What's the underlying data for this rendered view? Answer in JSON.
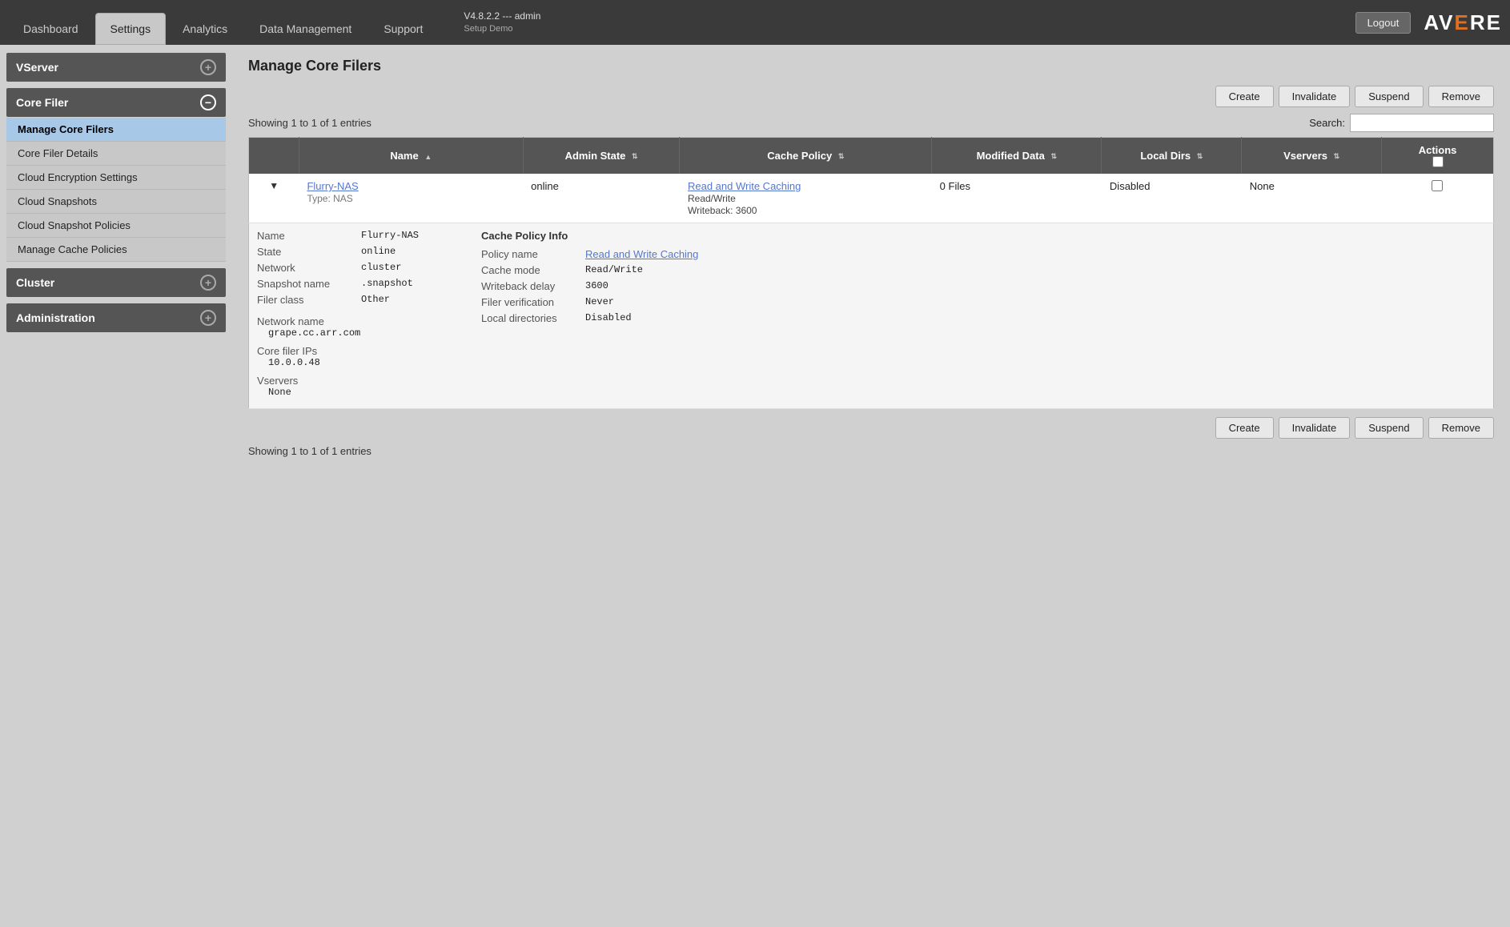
{
  "app": {
    "logo": "AVERE",
    "logo_accent": "E",
    "version": "V4.8.2.2 --- admin",
    "setup": "Setup Demo"
  },
  "top_nav": {
    "logout_label": "Logout",
    "tabs": [
      {
        "id": "dashboard",
        "label": "Dashboard",
        "active": false
      },
      {
        "id": "settings",
        "label": "Settings",
        "active": true
      },
      {
        "id": "analytics",
        "label": "Analytics",
        "active": false
      },
      {
        "id": "data-management",
        "label": "Data Management",
        "active": false
      },
      {
        "id": "support",
        "label": "Support",
        "active": false
      }
    ]
  },
  "sidebar": {
    "sections": [
      {
        "id": "vserver",
        "label": "VServer",
        "collapsed": true,
        "icon": "plus",
        "items": []
      },
      {
        "id": "core-filer",
        "label": "Core Filer",
        "collapsed": false,
        "icon": "minus",
        "items": [
          {
            "id": "manage-core-filers",
            "label": "Manage Core Filers",
            "active": true
          },
          {
            "id": "core-filer-details",
            "label": "Core Filer Details",
            "active": false
          },
          {
            "id": "cloud-encryption-settings",
            "label": "Cloud Encryption Settings",
            "active": false
          },
          {
            "id": "cloud-snapshots",
            "label": "Cloud Snapshots",
            "active": false
          },
          {
            "id": "cloud-snapshot-policies",
            "label": "Cloud Snapshot Policies",
            "active": false
          },
          {
            "id": "manage-cache-policies",
            "label": "Manage Cache Policies",
            "active": false
          }
        ]
      },
      {
        "id": "cluster",
        "label": "Cluster",
        "collapsed": true,
        "icon": "plus",
        "items": []
      },
      {
        "id": "administration",
        "label": "Administration",
        "collapsed": true,
        "icon": "plus",
        "items": []
      }
    ]
  },
  "content": {
    "page_title": "Manage Core Filers",
    "showing_text_top": "Showing 1 to 1 of 1 entries",
    "showing_text_bottom": "Showing 1 to 1 of 1 entries",
    "search_label": "Search:",
    "search_placeholder": "",
    "buttons": {
      "create": "Create",
      "invalidate": "Invalidate",
      "suspend": "Suspend",
      "remove": "Remove"
    },
    "table": {
      "columns": [
        {
          "id": "expand",
          "label": ""
        },
        {
          "id": "name",
          "label": "Name",
          "sortable": true,
          "sort_dir": "asc"
        },
        {
          "id": "admin-state",
          "label": "Admin State",
          "sortable": true
        },
        {
          "id": "cache-policy",
          "label": "Cache Policy",
          "sortable": true
        },
        {
          "id": "modified-data",
          "label": "Modified Data",
          "sortable": true
        },
        {
          "id": "local-dirs",
          "label": "Local Dirs",
          "sortable": true
        },
        {
          "id": "vservers",
          "label": "Vservers",
          "sortable": true
        },
        {
          "id": "actions",
          "label": "Actions",
          "has_checkbox": true
        }
      ],
      "rows": [
        {
          "id": "flurry-nas",
          "expanded": true,
          "name": "Flurry-NAS",
          "type": "NAS",
          "admin_state": "online",
          "cache_policy_link": "Read and Write Caching",
          "cache_policy_mode": "Read/Write",
          "cache_policy_writeback": "Writeback: 3600",
          "modified_data": "0 Files",
          "local_dirs": "Disabled",
          "vservers": "None"
        }
      ],
      "expanded_details": {
        "name_label": "Name",
        "name_value": "Flurry-NAS",
        "state_label": "State",
        "state_value": "online",
        "network_label": "Network",
        "network_value": "cluster",
        "snapshot_name_label": "Snapshot name",
        "snapshot_name_value": ".snapshot",
        "filer_class_label": "Filer class",
        "filer_class_value": "Other",
        "network_name_label": "Network name",
        "network_name_value": "grape.cc.arr.com",
        "core_filer_ips_label": "Core filer IPs",
        "core_filer_ips_value": "10.0.0.48",
        "vservers_label": "Vservers",
        "vservers_value": "None",
        "cache_policy_info_header": "Cache Policy Info",
        "policy_name_label": "Policy name",
        "policy_name_value": "Read and Write Caching",
        "cache_mode_label": "Cache mode",
        "cache_mode_value": "Read/Write",
        "writeback_delay_label": "Writeback delay",
        "writeback_delay_value": "3600",
        "filer_verification_label": "Filer verification",
        "filer_verification_value": "Never",
        "local_directories_label": "Local directories",
        "local_directories_value": "Disabled"
      }
    }
  }
}
